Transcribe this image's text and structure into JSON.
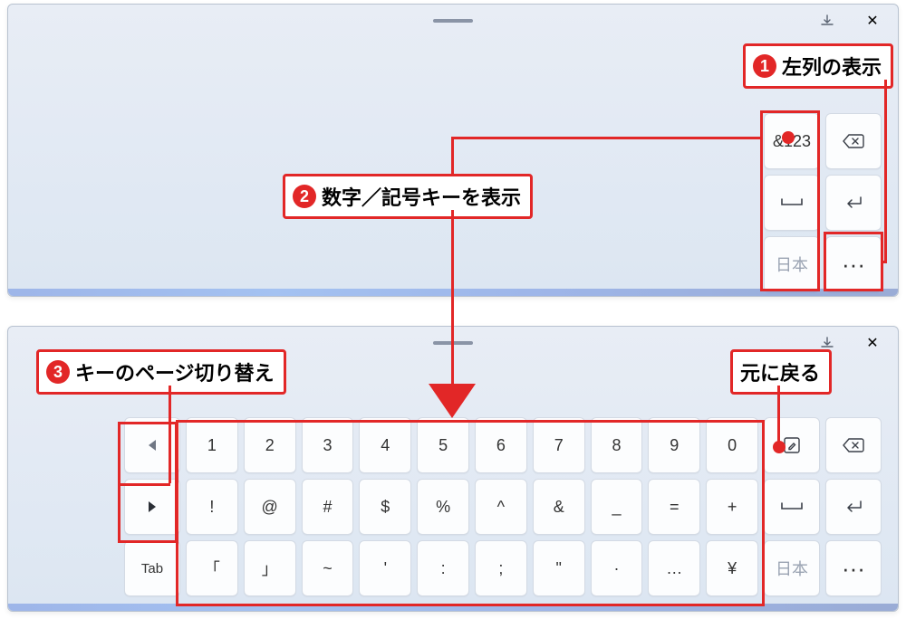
{
  "callouts": {
    "c1": "左列の表示",
    "c2": "数字／記号キーを表示",
    "c3": "キーのページ切り替え",
    "c4": "元に戻る"
  },
  "top": {
    "right_col": {
      "k_sym": "&123",
      "k_backspace": "⌫",
      "k_space": "␣",
      "k_enter": "↵",
      "k_lang": "日本",
      "k_more": "···"
    }
  },
  "bot": {
    "side": {
      "prev": "◀",
      "next": "▶",
      "tab": "Tab"
    },
    "row1": [
      "1",
      "2",
      "3",
      "4",
      "5",
      "6",
      "7",
      "8",
      "9",
      "0"
    ],
    "row2": [
      "!",
      "@",
      "#",
      "$",
      "%",
      "^",
      "&",
      "_",
      "=",
      "+"
    ],
    "row3": [
      "「",
      "」",
      "~",
      "'",
      ":",
      ";",
      "\"",
      "·",
      "…",
      "¥"
    ],
    "right": {
      "k_pencil": "✎",
      "k_backspace": "⌫",
      "k_space": "␣",
      "k_enter": "↵",
      "k_lang": "日本",
      "k_more": "···"
    }
  },
  "icons": {
    "dock": "⇤",
    "close": "✕"
  }
}
